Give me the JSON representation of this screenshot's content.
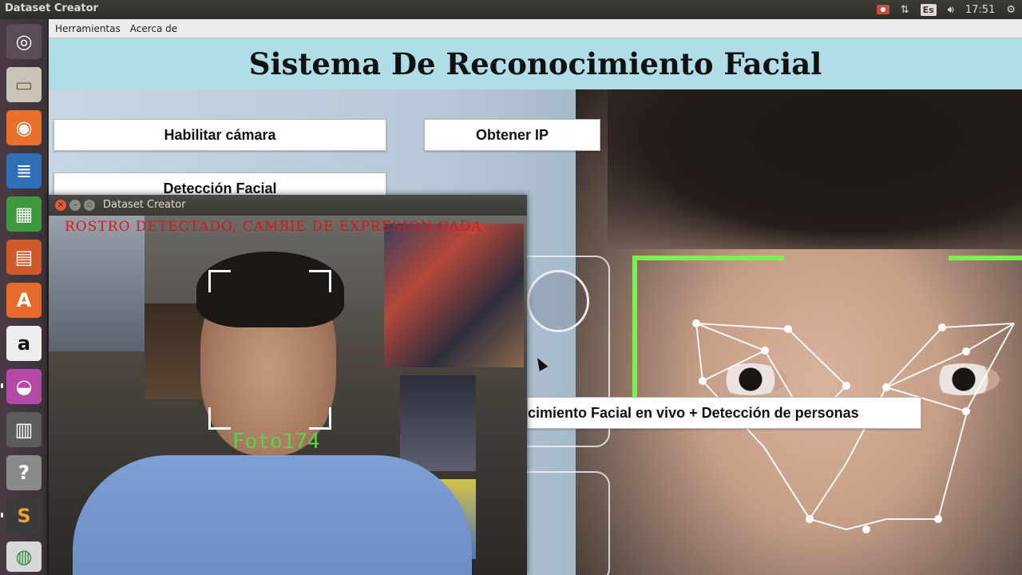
{
  "top_panel": {
    "app_title": "Dataset Creator",
    "keyboard_layout": "Es",
    "clock": "17:51"
  },
  "launcher": {
    "items": [
      {
        "name": "ubuntu-dash",
        "glyph": "◎"
      },
      {
        "name": "file-manager",
        "glyph": "▭"
      },
      {
        "name": "firefox",
        "glyph": "◉"
      },
      {
        "name": "writer",
        "glyph": "≣"
      },
      {
        "name": "calc",
        "glyph": "▦"
      },
      {
        "name": "impress",
        "glyph": "▤"
      },
      {
        "name": "software-center",
        "glyph": "A"
      },
      {
        "name": "amazon",
        "glyph": "a"
      },
      {
        "name": "video-app",
        "glyph": "◒"
      },
      {
        "name": "workspaces",
        "glyph": "▥"
      },
      {
        "name": "help",
        "glyph": "?"
      },
      {
        "name": "sublime",
        "glyph": "S"
      },
      {
        "name": "chrome",
        "glyph": "◍"
      }
    ]
  },
  "app": {
    "menu": [
      "Herramientas",
      "Acerca de"
    ],
    "title": "Sistema De Reconocimiento Facial",
    "buttons": {
      "enable_camera": "Habilitar cámara",
      "get_ip": "Obtener IP",
      "face_detection": "Detección Facial",
      "live_recognition": "cimiento Facial en vivo + Detección de personas"
    }
  },
  "camera_window": {
    "title": "Dataset Creator",
    "warning_text": "ROSTRO DETECTADO, CAMBIE DE EXPRESION CADA",
    "photo_label": "Foto174",
    "warning_color": "#d21b1b",
    "label_color": "#5ad24a"
  },
  "colors": {
    "header_bg": "#b1dde8",
    "hud_green": "#7cf04e"
  }
}
